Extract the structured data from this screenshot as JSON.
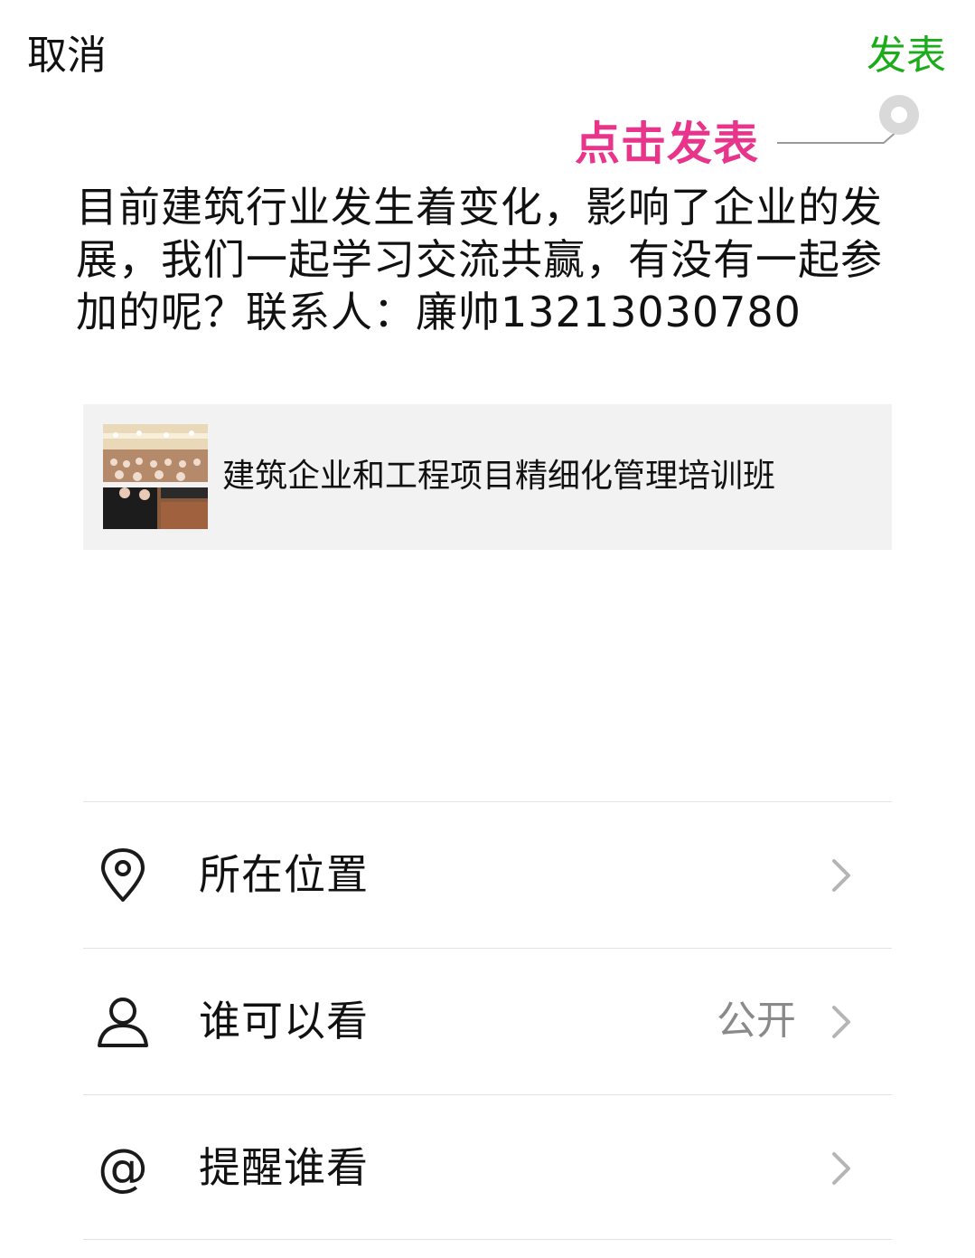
{
  "header": {
    "cancel_label": "取消",
    "publish_label": "发表",
    "publish_color": "#1aad19"
  },
  "annotation": {
    "hint_text": "点击发表",
    "hint_color": "#e8348a"
  },
  "post": {
    "text": "目前建筑行业发生着变化，影响了企业的发展，我们一起学习交流共赢，有没有一起参加的呢？联系人：廉帅13213030780"
  },
  "link_card": {
    "title": "建筑企业和工程项目精细化管理培训班",
    "thumbnail": "conference-room-photo"
  },
  "options": [
    {
      "icon": "location-pin-icon",
      "label": "所在位置",
      "value": ""
    },
    {
      "icon": "person-icon",
      "label": "谁可以看",
      "value": "公开"
    },
    {
      "icon": "at-sign-icon",
      "label": "提醒谁看",
      "value": ""
    }
  ]
}
